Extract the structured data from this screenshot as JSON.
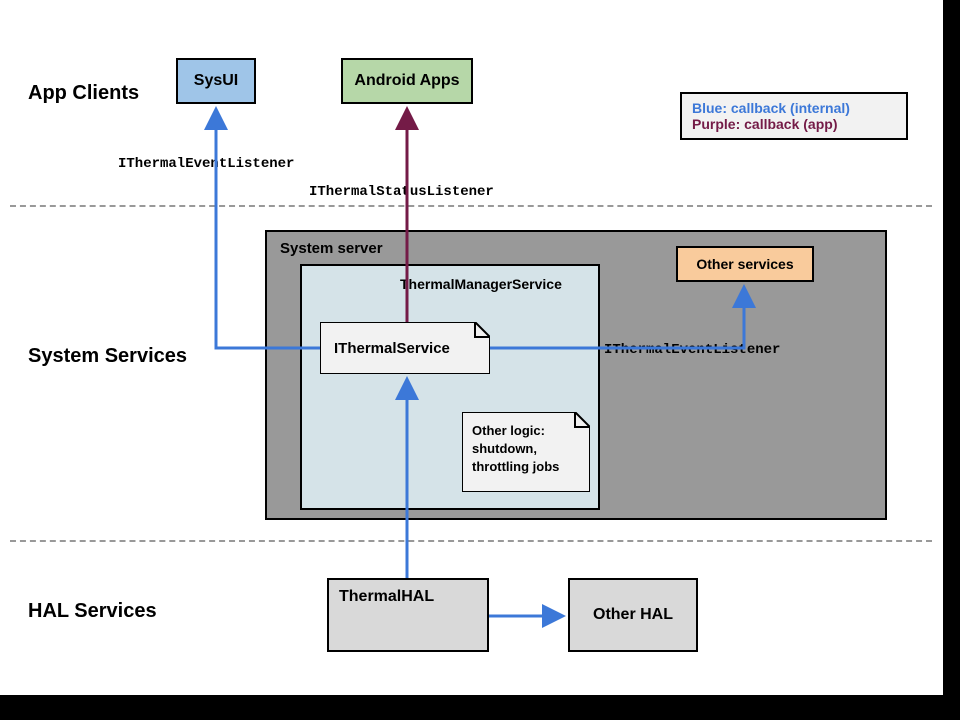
{
  "sections": {
    "app_clients": "App Clients",
    "system_services": "System Services",
    "hal_services": "HAL Services"
  },
  "boxes": {
    "sysui": "SysUI",
    "android_apps": "Android Apps",
    "system_server": "System server",
    "thermal_manager_service": "ThermalManagerService",
    "ithermal_service": "IThermalService",
    "other_logic_l1": "Other logic:",
    "other_logic_l2": "shutdown,",
    "other_logic_l3": "throttling jobs",
    "other_services": "Other services",
    "thermal_hal": "ThermalHAL",
    "other_hal": "Other HAL"
  },
  "labels": {
    "ithermal_event_listener_left": "IThermalEventListener",
    "ithermal_status_listener": "IThermalStatusListener",
    "ithermal_event_listener_right": "IThermalEventListener"
  },
  "legend": {
    "blue": "Blue: callback (internal)",
    "purple": "Purple: callback (app)"
  },
  "colors": {
    "blue": "#3c78d8",
    "purple": "#741b47",
    "sysui_bg": "#9fc5e8",
    "apps_bg": "#b6d7a8",
    "other_services_bg": "#f9cb9c",
    "grey_light": "#d9d9d9",
    "grey_mid": "#999999",
    "tms_bg": "#d5e3e8",
    "note_bg": "#f2f2f2"
  }
}
